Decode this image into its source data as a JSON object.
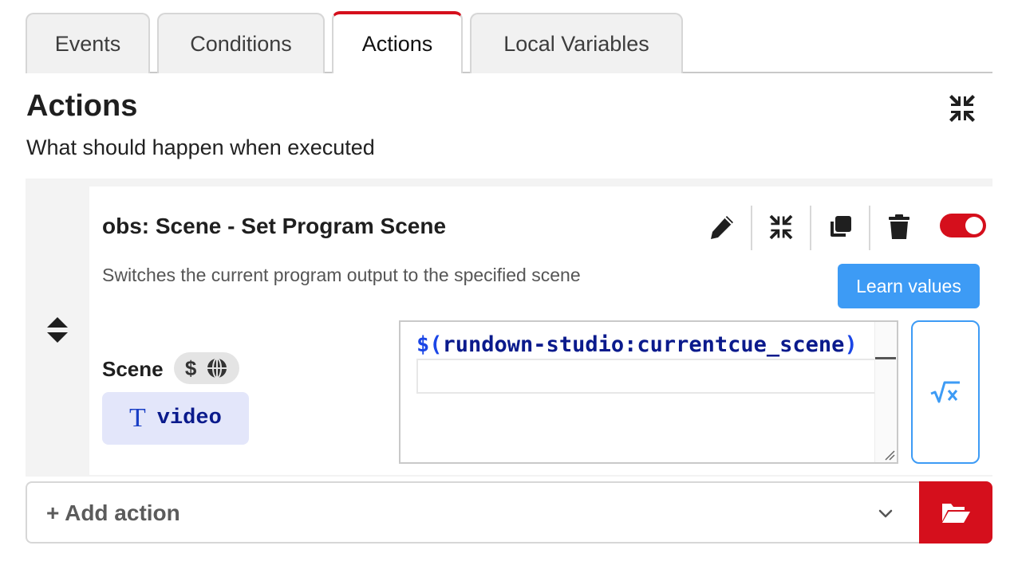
{
  "tabs": [
    {
      "label": "Events",
      "active": false
    },
    {
      "label": "Conditions",
      "active": false
    },
    {
      "label": "Actions",
      "active": true
    },
    {
      "label": "Local Variables",
      "active": false
    }
  ],
  "section": {
    "title": "Actions",
    "subtitle": "What should happen when executed"
  },
  "action": {
    "title": "obs: Scene - Set Program Scene",
    "description": "Switches the current program output to the specified scene",
    "enabled": true,
    "learn_label": "Learn values",
    "field": {
      "label": "Scene",
      "badge_symbol": "$",
      "type_icon": "T",
      "type_label": "video",
      "expression_prefix": "$(",
      "expression_body": "rundown-studio:currentcue_scene",
      "expression_suffix": ")"
    }
  },
  "add_action": {
    "label": "+ Add action"
  },
  "icons": {
    "collapse_all": "collapse-icon",
    "drag": "drag-handle-icon",
    "edit": "pencil-icon",
    "collapse": "collapse-icon",
    "duplicate": "duplicate-icon",
    "delete": "trash-icon",
    "variables": "globe-icon",
    "fx": "sqrt-x-icon",
    "dropdown": "chevron-down-icon",
    "import": "folder-open-icon"
  },
  "colors": {
    "accent_red": "#d50f1c",
    "accent_blue": "#3d9bf5",
    "chip_bg": "#e3e6fa"
  }
}
